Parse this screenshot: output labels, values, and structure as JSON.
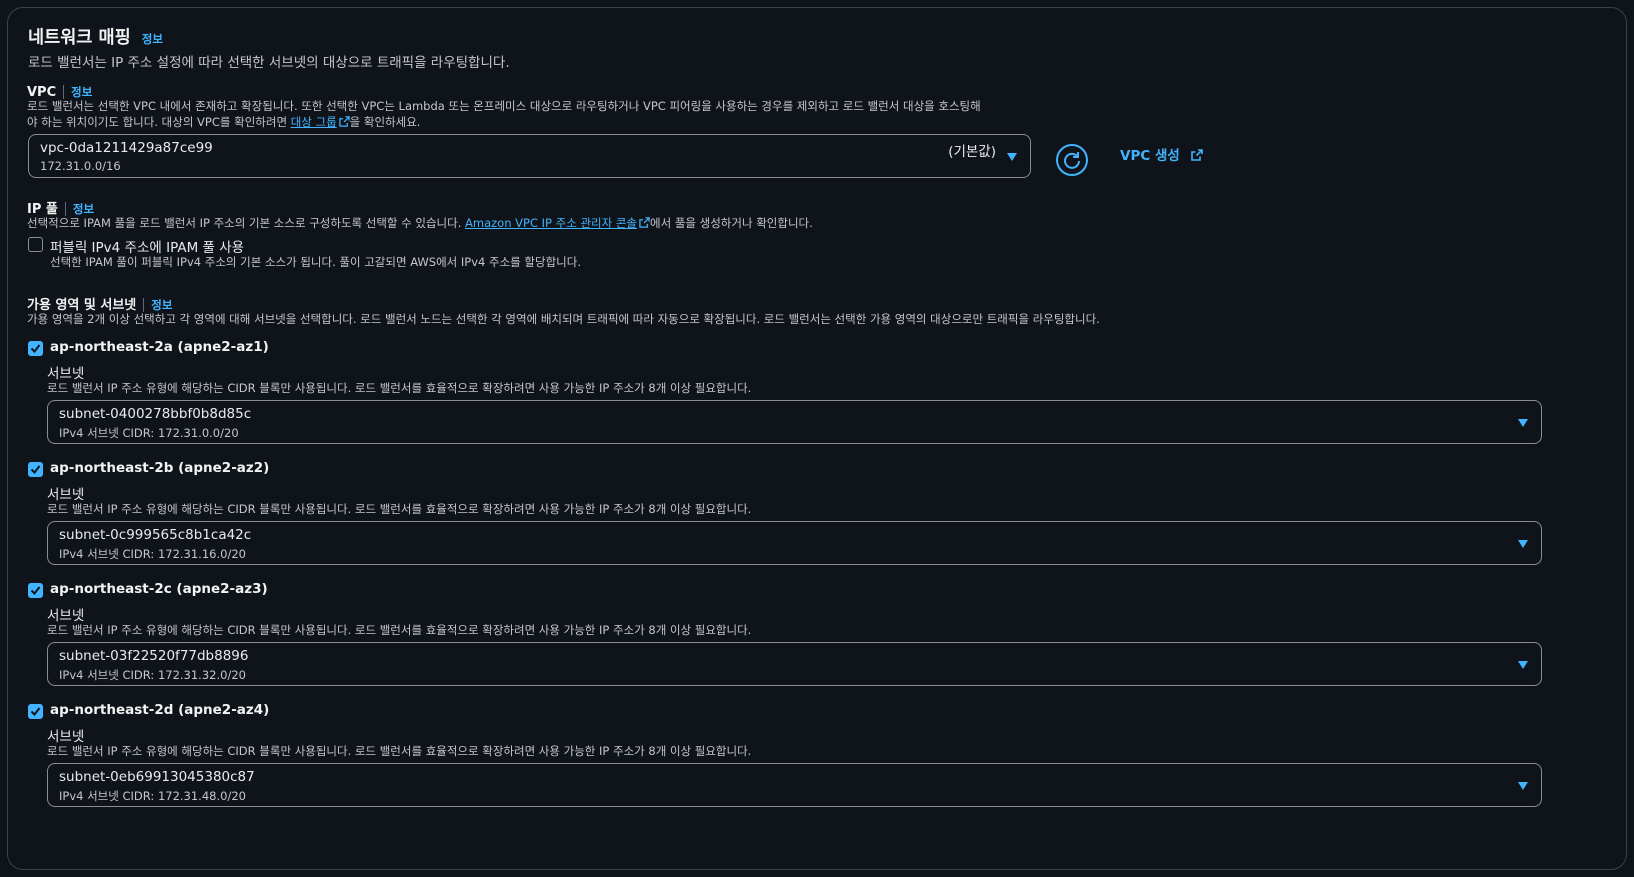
{
  "section": {
    "title": "네트워크 매핑",
    "info": "정보",
    "description": "로드 밸런서는 IP 주소 설정에 따라 선택한 서브넷의 대상으로 트래픽을 라우팅합니다."
  },
  "vpc": {
    "label": "VPC",
    "info": "정보",
    "desc_line1": "로드 밸런서는 선택한 VPC 내에서 존재하고 확장됩니다. 또한 선택한 VPC는 Lambda 또는 온프레미스 대상으로 라우팅하거나 VPC 피어링을 사용하는 경우를 제외하고 로드 밸런서 대상을 호스팅해",
    "desc_line2_prefix": "야 하는 위치이기도 합니다. 대상의 VPC를 확인하려면 ",
    "desc_link": "대상 그룹",
    "desc_line2_suffix": "을 확인하세요.",
    "selected_id": "vpc-0da1211429a87ce99",
    "selected_cidr": "172.31.0.0/16",
    "default_tag": "(기본값)",
    "create_label": "VPC 생성"
  },
  "ip_pool": {
    "label": "IP 풀",
    "info": "정보",
    "desc_prefix": "선택적으로 IPAM 풀을 로드 밸런서 IP 주소의 기본 소스로 구성하도록 선택할 수 있습니다. ",
    "desc_link": "Amazon VPC IP 주소 관리자 콘솔",
    "desc_suffix": "에서 풀을 생성하거나 확인합니다.",
    "checkbox_label": "퍼블릭 IPv4 주소에 IPAM 풀 사용",
    "checkbox_checked": false,
    "checkbox_desc": "선택한 IPAM 풀이 퍼블릭 IPv4 주소의 기본 소스가 됩니다. 풀이 고갈되면 AWS에서 IPv4 주소를 할당합니다."
  },
  "az": {
    "label": "가용 영역 및 서브넷",
    "info": "정보",
    "description": "가용 영역을 2개 이상 선택하고 각 영역에 대해 서브넷을 선택합니다. 로드 밸런서 노드는 선택한 각 영역에 배치되며 트래픽에 따라 자동으로 확장됩니다. 로드 밸런서는 선택한 가용 영역의 대상으로만 트래픽을 라우팅합니다.",
    "zones": [
      {
        "name": "ap-northeast-2a (apne2-az1)",
        "checked": true,
        "subnet_label": "서브넷",
        "subnet_desc": "로드 밸런서 IP 주소 유형에 해당하는 CIDR 블록만 사용됩니다. 로드 밸런서를 효율적으로 확장하려면 사용 가능한 IP 주소가 8개 이상 필요합니다.",
        "subnet_id": "subnet-0400278bbf0b8d85c",
        "subnet_cidr": "IPv4 서브넷 CIDR: 172.31.0.0/20"
      },
      {
        "name": "ap-northeast-2b (apne2-az2)",
        "checked": true,
        "subnet_label": "서브넷",
        "subnet_desc": "로드 밸런서 IP 주소 유형에 해당하는 CIDR 블록만 사용됩니다. 로드 밸런서를 효율적으로 확장하려면 사용 가능한 IP 주소가 8개 이상 필요합니다.",
        "subnet_id": "subnet-0c999565c8b1ca42c",
        "subnet_cidr": "IPv4 서브넷 CIDR: 172.31.16.0/20"
      },
      {
        "name": "ap-northeast-2c (apne2-az3)",
        "checked": true,
        "subnet_label": "서브넷",
        "subnet_desc": "로드 밸런서 IP 주소 유형에 해당하는 CIDR 블록만 사용됩니다. 로드 밸런서를 효율적으로 확장하려면 사용 가능한 IP 주소가 8개 이상 필요합니다.",
        "subnet_id": "subnet-03f22520f77db8896",
        "subnet_cidr": "IPv4 서브넷 CIDR: 172.31.32.0/20"
      },
      {
        "name": "ap-northeast-2d (apne2-az4)",
        "checked": true,
        "subnet_label": "서브넷",
        "subnet_desc": "로드 밸런서 IP 주소 유형에 해당하는 CIDR 블록만 사용됩니다. 로드 밸런서를 효율적으로 확장하려면 사용 가능한 IP 주소가 8개 이상 필요합니다.",
        "subnet_id": "subnet-0eb69913045380c87",
        "subnet_cidr": "IPv4 서브넷 CIDR: 172.31.48.0/20"
      }
    ]
  },
  "colors": {
    "background": "#0f141a",
    "accent": "#42b4ff",
    "border": "#8c8c94",
    "text": "#f2f3f3"
  }
}
